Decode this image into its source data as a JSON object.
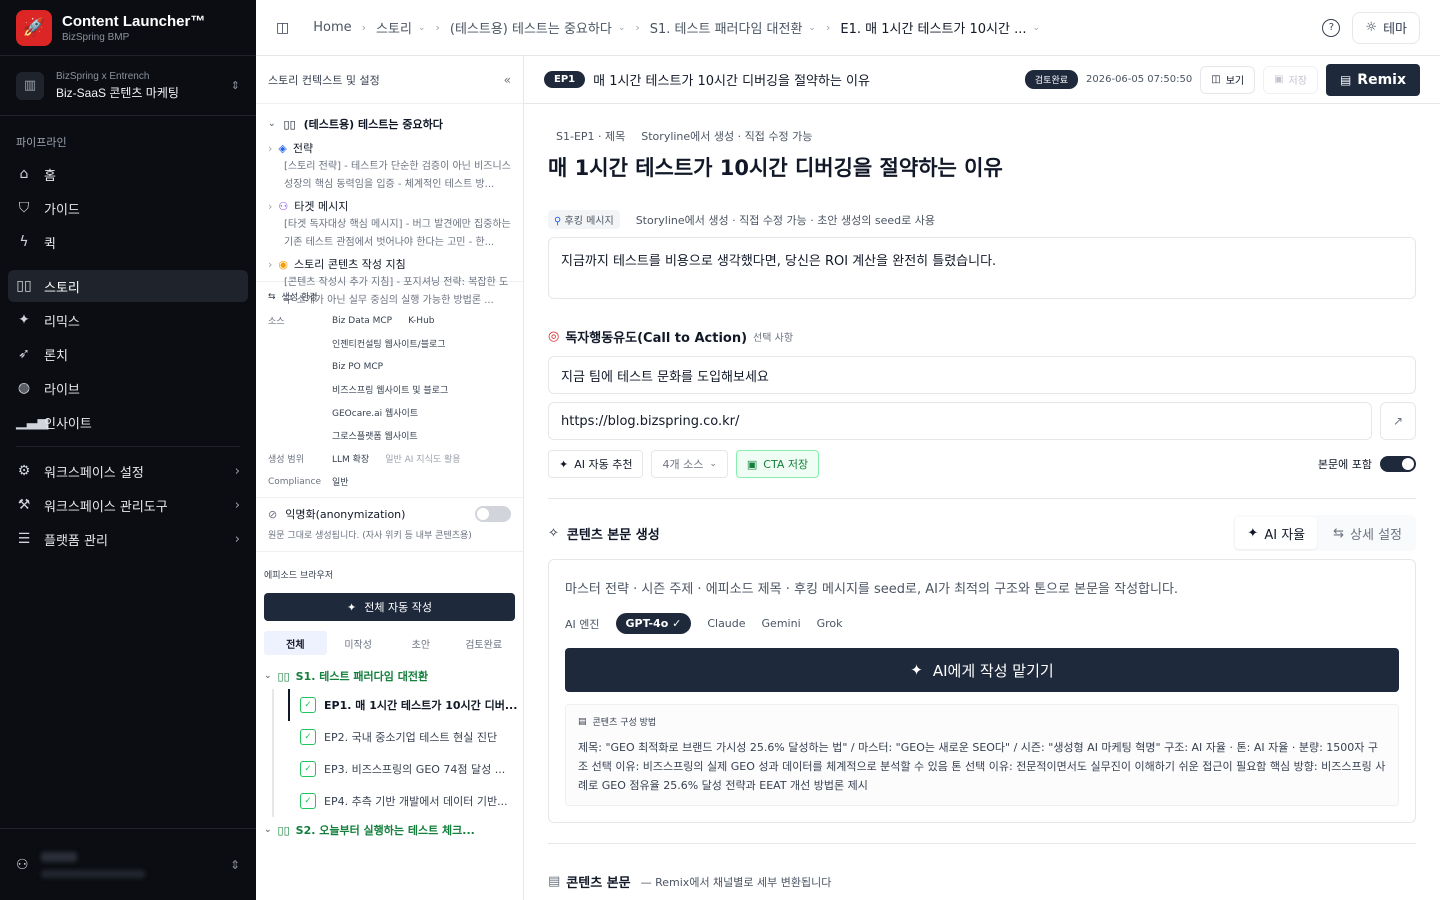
{
  "app": {
    "title": "Content Launcher™",
    "subtitle": "BizSpring BMP"
  },
  "workspace": {
    "org": "BizSpring x Entrench",
    "name": "Biz-SaaS 콘텐츠 마케팅"
  },
  "sidebar": {
    "section_label": "파이프라인",
    "items": [
      {
        "label": "홈",
        "icon": "home-icon"
      },
      {
        "label": "가이드",
        "icon": "shield-icon"
      },
      {
        "label": "퀵",
        "icon": "bolt-icon"
      },
      {
        "label": "스토리",
        "icon": "book-icon"
      },
      {
        "label": "리믹스",
        "icon": "wand-icon"
      },
      {
        "label": "론치",
        "icon": "rocket-icon"
      },
      {
        "label": "라이브",
        "icon": "globe-icon"
      },
      {
        "label": "인사이트",
        "icon": "chart-icon"
      }
    ],
    "settings": [
      {
        "label": "워크스페이스 설정"
      },
      {
        "label": "워크스페이스 관리도구"
      },
      {
        "label": "플랫폼 관리"
      }
    ]
  },
  "breadcrumb": {
    "home": "Home",
    "story": "스토리",
    "master": "(테스트용) 테스트는 중요하다",
    "season": "S1. 테스트 패러다임 대전환",
    "episode": "E1. 매 1시간 테스트가 10시간 ..."
  },
  "top": {
    "theme_label": "테마"
  },
  "panel": {
    "title": "스토리 컨텍스트 및 설정",
    "root": "(테스트용) 테스트는 중요하다",
    "nodes": [
      {
        "label": "전략",
        "desc": "[스토리 전략] - 테스트가 단순한 검증이 아닌 비즈니스 성장의 핵심 동력임을 입증 - 체계적인 테스트 방..."
      },
      {
        "label": "타겟 메시지",
        "desc": "[타겟 독자대상 핵심 메시지] - 버그 발견에만 집중하는 기존 테스트 관점에서 벗어나야 한다는 고민 - 한..."
      },
      {
        "label": "스토리 콘텐츠 작성 지침",
        "desc": "[콘텐츠 작성시 추가 지침] - 포지셔닝 전략: 복잡한 도구 소개가 아닌 실무 중심의 실행 가능한 방법론 ..."
      }
    ],
    "gen_env": {
      "title": "생성 환경",
      "source_label": "소스",
      "sources": [
        [
          "Biz Data MCP",
          "K-Hub"
        ],
        [
          "인젠티컨설팅 웹사이트/블로그"
        ],
        [
          "Biz PO MCP"
        ],
        [
          "비즈스프링 웹사이트 및 블로그"
        ],
        [
          "GEOcare.ai 웹사이트"
        ],
        [
          "그로스플랫폼 웹사이트"
        ]
      ],
      "scope_label": "생성 범위",
      "scope_value": "LLM 확장",
      "scope_note": "일반 AI 지식도 활용",
      "compliance_label": "Compliance",
      "compliance_value": "일반"
    },
    "anon": {
      "label": "익명화(anonymization)",
      "desc": "원문 그대로 생성됩니다. (자사 위키 등 내부 콘텐츠용)"
    },
    "episode_browser": "에피소드 브라우저",
    "auto_write": "전체 자동 작성",
    "tabs": [
      "전체",
      "미작성",
      "초안",
      "검토완료"
    ],
    "season1": "S1. 테스트 패러다임 대전환",
    "episodes": [
      "EP1. 매 1시간 테스트가 10시간 디버...",
      "EP2. 국내 중소기업 테스트 현실 진단",
      "EP3. 비즈스프링의 GEO 74점 달성 ...",
      "EP4. 추측 기반 개발에서 데이터 기반..."
    ],
    "season2": "S2. 오늘부터 실행하는 테스트 체크..."
  },
  "content": {
    "ep_pill": "EP1",
    "header_title": "매 1시간 테스트가 10시간 디버깅을 절약하는 이유",
    "status": "검토완료",
    "timestamp": "2026-06-05 07:50:50",
    "view_label": "보기",
    "save_label": "저장",
    "remix_label": "Remix",
    "meta_label": "S1-EP1 · 제목",
    "meta_note": "Storyline에서 생성 · 직접 수정 가능",
    "title": "매 1시간 테스트가 10시간 디버깅을 절약하는 이유",
    "hook_label": "후킹 메시지",
    "hook_note": "Storyline에서 생성 · 직접 수정 가능 · 초안 생성의 seed로 사용",
    "hook_text": "지금까지 테스트를 비용으로 생각했다면, 당신은 ROI 계산을 완전히 틀렸습니다.",
    "cta_title": "독자행동유도(Call to Action)",
    "cta_optional": "선택 사항",
    "cta_text": "지금 팀에 테스트 문화를 도입해보세요",
    "cta_url": "https://blog.bizspring.co.kr/",
    "ai_recommend": "AI 자동 추천",
    "sources_label": "4개 소스",
    "cta_save": "CTA 저장",
    "include_label": "본문에 포함",
    "gen_title": "콘텐츠 본문 생성",
    "seg_ai": "AI 자율",
    "seg_detail": "상세 설정",
    "gen_desc": "마스터 전략 · 시즌 주제 · 에피소드 제목 · 후킹 메시지를 seed로, AI가 최적의 구조와 톤으로 본문을 작성합니다.",
    "engine_label": "AI 엔진",
    "engines": [
      "GPT-4o",
      "Claude",
      "Gemini",
      "Grok"
    ],
    "ai_write": "AI에게 작성 맡기기",
    "method_title": "콘텐츠 구성 방법",
    "method_body": "제목: \"GEO 최적화로 브랜드 가시성 25.6% 달성하는 법\" / 마스터: \"GEO는 새로운 SEO다\" / 시즌: \"생성형 AI 마케팅 혁명\" 구조: AI 자율 · 톤: AI 자율 · 분량: 1500자 구조 선택 이유: 비즈스프링의 실제 GEO 성과 데이터를 체계적으로 분석할 수 있음 톤 선택 이유: 전문적이면서도 실무진이 이해하기 쉬운 접근이 필요함 핵심 방향: 비즈스프링 사례로 GEO 점유율 25.6% 달성 전략과 EEAT 개선 방법론 제시",
    "body_title": "콘텐츠 본문",
    "body_note": "— Remix에서 채널별로 세부 변환됩니다"
  }
}
